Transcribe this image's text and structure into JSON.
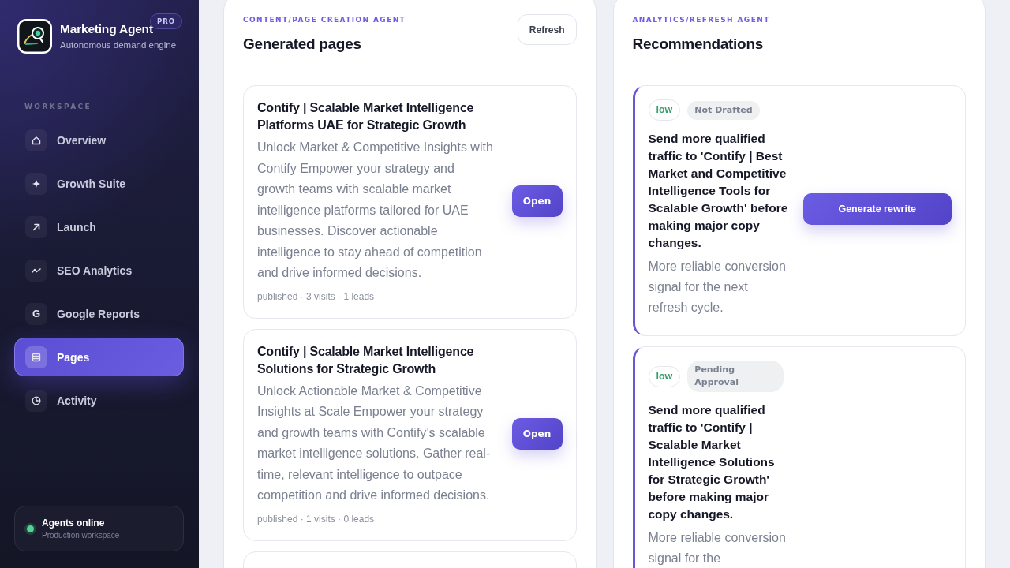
{
  "sidebar": {
    "brand": {
      "title": "Marketing Agent",
      "subtitle": "Autonomous demand engine",
      "badge": "PRO"
    },
    "section_label": "WORKSPACE",
    "items": [
      {
        "label": "Overview",
        "kind": "home",
        "selected": false
      },
      {
        "label": "Growth Suite",
        "kind": "sparkle",
        "selected": false
      },
      {
        "label": "Launch",
        "kind": "arrow",
        "selected": false
      },
      {
        "label": "SEO Analytics",
        "kind": "wave",
        "selected": false
      },
      {
        "label": "Google Reports",
        "kind": "letter",
        "glyph": "G",
        "selected": false
      },
      {
        "label": "Pages",
        "kind": "list",
        "selected": true
      },
      {
        "label": "Activity",
        "kind": "clock",
        "selected": false
      }
    ],
    "status": {
      "title": "Agents online",
      "subtitle": "Production workspace",
      "online": true
    }
  },
  "pages_panel": {
    "eyebrow": "CONTENT/PAGE CREATION AGENT",
    "title": "Generated pages",
    "refresh_button": "Refresh",
    "pages": [
      {
        "title": "Contify | Scalable Market Intelligence Platforms UAE for Strategic Growth",
        "description": "Unlock Market & Competitive Insights with Contify Empower your strategy and growth teams with scalable market intelligence platforms tailored for UAE businesses. Discover actionable intelligence to stay ahead of competition and drive informed decisions.",
        "meta": "published · 3 visits · 1 leads",
        "button": "Open"
      },
      {
        "title": "Contify | Scalable Market Intelligence Solutions for Strategic Growth",
        "description": "Unlock Actionable Market & Competitive Insights at Scale Empower your strategy and growth teams with Contify’s scalable market intelligence solutions. Gather real-time, relevant intelligence to outpace competition and drive informed decisions.",
        "meta": "published · 1 visits · 0 leads",
        "button": "Open"
      }
    ]
  },
  "recommendations_panel": {
    "eyebrow": "ANALYTICS/REFRESH AGENT",
    "title": "Recommendations",
    "items": [
      {
        "priority": "low",
        "status": "Not Drafted",
        "text": "Send more qualified traffic to 'Contify | Best Market and Competitive Intelligence Tools for Scalable Growth' before making major copy changes.",
        "reason": "More reliable conversion signal for the next refresh cycle.",
        "button": "Generate rewrite"
      },
      {
        "priority": "low",
        "status": "Pending Approval",
        "text": "Send more qualified traffic to 'Contify | Scalable Market Intelligence Solutions for Strategic Growth' before making major copy changes.",
        "reason": "More reliable conversion signal for the"
      }
    ]
  }
}
